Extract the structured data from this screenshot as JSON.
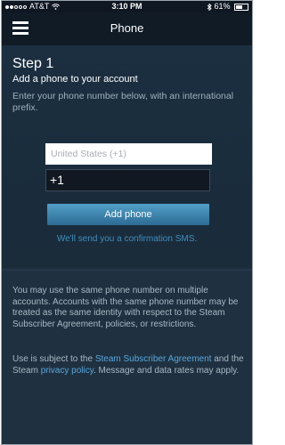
{
  "status": {
    "carrier": "AT&T",
    "time": "3:10 PM",
    "battery": "61%"
  },
  "nav": {
    "title": "Phone"
  },
  "content": {
    "step": "Step 1",
    "subtitle": "Add a phone to your account",
    "description": "Enter your phone number below, with an international prefix.",
    "country_placeholder": "United States (+1)",
    "phone_value": "+1",
    "add_button": "Add phone",
    "sms_note": "We'll send you a confirmation SMS."
  },
  "footer": {
    "info": "You may use the same phone number on multiple accounts. Accounts with the same phone number may be treated as the same identity with respect to the Steam Subscriber Agreement, policies, or restrictions.",
    "terms_prefix": "Use is subject to the ",
    "terms_link1": "Steam Subscriber Agreement",
    "terms_mid": " and the Steam ",
    "terms_link2": "privacy policy",
    "terms_suffix": ". Message and data rates may apply."
  },
  "colors": {
    "background": "#1f3140",
    "navbar": "#101b26",
    "accent": "#3e8fbf",
    "button": "#2c6b94"
  }
}
